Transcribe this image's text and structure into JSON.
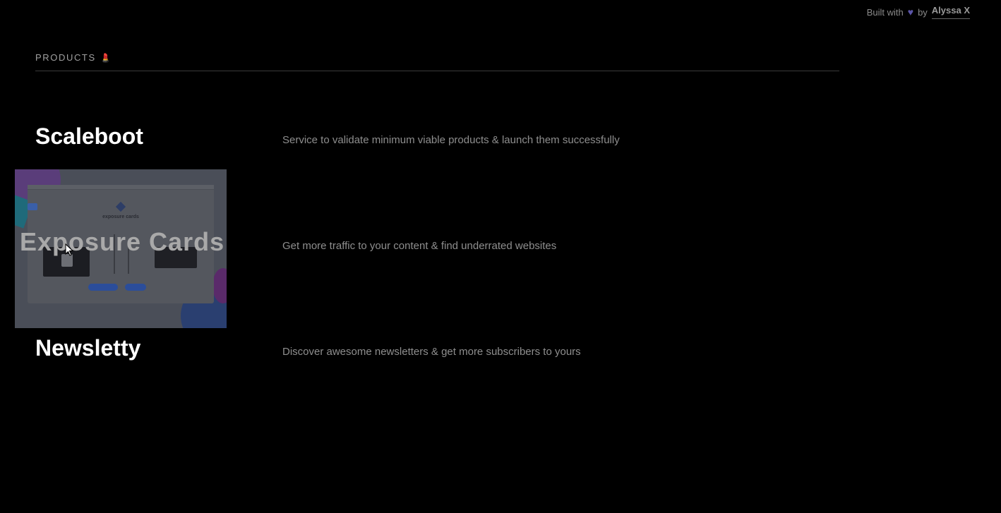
{
  "credit": {
    "prefix": "Built with",
    "icon": "heart-icon",
    "by": "by",
    "author": "Alyssa X"
  },
  "section": {
    "title": "PRODUCTS",
    "emoji": "💄"
  },
  "products": [
    {
      "name": "Scaleboot",
      "description": "Service to validate minimum viable products & launch them successfully"
    },
    {
      "name": "Exposure Cards",
      "description": "Get more traffic to your content & find underrated websites",
      "preview_title": "exposure cards"
    },
    {
      "name": "Newsletty",
      "description": "Discover awesome newsletters & get more subscribers to yours"
    }
  ],
  "colors": {
    "background": "#000000",
    "heart": "#5b55a8",
    "text_primary": "#ffffff",
    "text_muted": "#8e8e8e"
  }
}
